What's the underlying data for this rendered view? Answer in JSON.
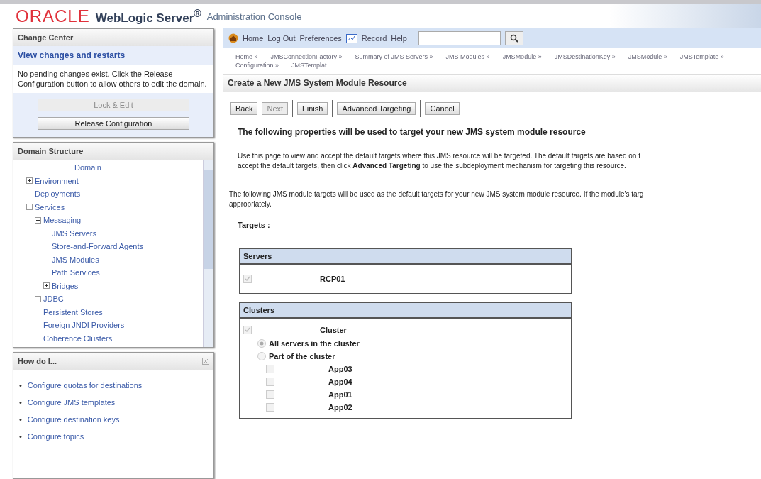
{
  "header": {
    "brand": "ORACLE",
    "product": "WebLogic Server",
    "product_mark": "®",
    "subtitle": "Administration Console"
  },
  "change_center": {
    "title": "Change Center",
    "link": "View changes and restarts",
    "message": "No pending changes exist. Click the Release Configuration button to allow others to edit the domain.",
    "buttons": [
      {
        "label": "Lock & Edit",
        "disabled": true
      },
      {
        "label": "Release Configuration",
        "disabled": false
      }
    ]
  },
  "domain_structure": {
    "title": "Domain Structure",
    "tree": [
      {
        "label": "Domain",
        "children": [
          {
            "label": "Environment",
            "expanded": false
          },
          {
            "label": "Deployments"
          },
          {
            "label": "Services",
            "expanded": true,
            "children": [
              {
                "label": "Messaging",
                "expanded": true,
                "children": [
                  {
                    "label": "JMS Servers"
                  },
                  {
                    "label": "Store-and-Forward Agents"
                  },
                  {
                    "label": "JMS Modules"
                  },
                  {
                    "label": "Path Services"
                  },
                  {
                    "label": "Bridges",
                    "expanded": false
                  }
                ]
              },
              {
                "label": "JDBC",
                "expanded": false
              },
              {
                "label": "Persistent Stores"
              },
              {
                "label": "Foreign JNDI Providers"
              },
              {
                "label": "Coherence Clusters"
              }
            ]
          }
        ]
      }
    ]
  },
  "how_do_i": {
    "title": "How do I...",
    "links": [
      {
        "bullet": "•",
        "label": "Configure quotas for destinations"
      },
      {
        "bullet": "•",
        "label": "Configure JMS templates"
      },
      {
        "bullet": "•",
        "label": "Configure destination keys"
      },
      {
        "bullet": "•",
        "label": "Configure topics"
      }
    ]
  },
  "toolbar": {
    "links": [
      "Home",
      "Log Out",
      "Preferences",
      "Record",
      "Help"
    ],
    "search": {
      "kind": "text"
    }
  },
  "breadcrumb": [
    "Home »",
    "JMSConnectionFactory »",
    "Summary of JMS Servers »",
    "JMS Modules »",
    "JMSModule »",
    "JMSDestinationKey »",
    "JMSModule »",
    "JMSTemplate »",
    "Configuration »",
    "JMSTemplat"
  ],
  "page": {
    "title": "Create a New JMS System Module Resource",
    "buttons": [
      {
        "label": "Back",
        "disabled": false
      },
      {
        "label": "Next",
        "disabled": true
      },
      {
        "label": "Finish",
        "disabled": false
      },
      {
        "label": "Advanced Targeting",
        "disabled": false
      },
      {
        "label": "Cancel",
        "disabled": false
      }
    ],
    "heading": "The following properties will be used to target your new JMS system module resource",
    "intro": [
      "Use this page to view and accept the default targets where this JMS resource will be targeted. The default targets are based on t",
      "accept the default targets, then click **Advanced Targeting** to use the subdeployment mechanism for targeting this resource."
    ],
    "note": [
      "The following JMS module targets will be used as the default targets for your new JMS system module resource. If the module's targ",
      "appropriately."
    ],
    "targets_label": "Targets :",
    "servers": {
      "title": "Servers",
      "items": [
        {
          "label": "RCP01",
          "checked": true,
          "disabled": true
        }
      ]
    },
    "clusters": {
      "title": "Clusters",
      "items": [
        {
          "label": "Cluster",
          "checked": true,
          "disabled": true,
          "options": [
            {
              "label": "All servers in the cluster",
              "selected": true
            },
            {
              "label": "Part of the cluster",
              "selected": false
            }
          ],
          "members": [
            {
              "label": "App03",
              "checked": false,
              "disabled": true
            },
            {
              "label": "App04",
              "checked": false,
              "disabled": true
            },
            {
              "label": "App01",
              "checked": false,
              "disabled": true
            },
            {
              "label": "App02",
              "checked": false,
              "disabled": true
            }
          ]
        }
      ]
    }
  }
}
